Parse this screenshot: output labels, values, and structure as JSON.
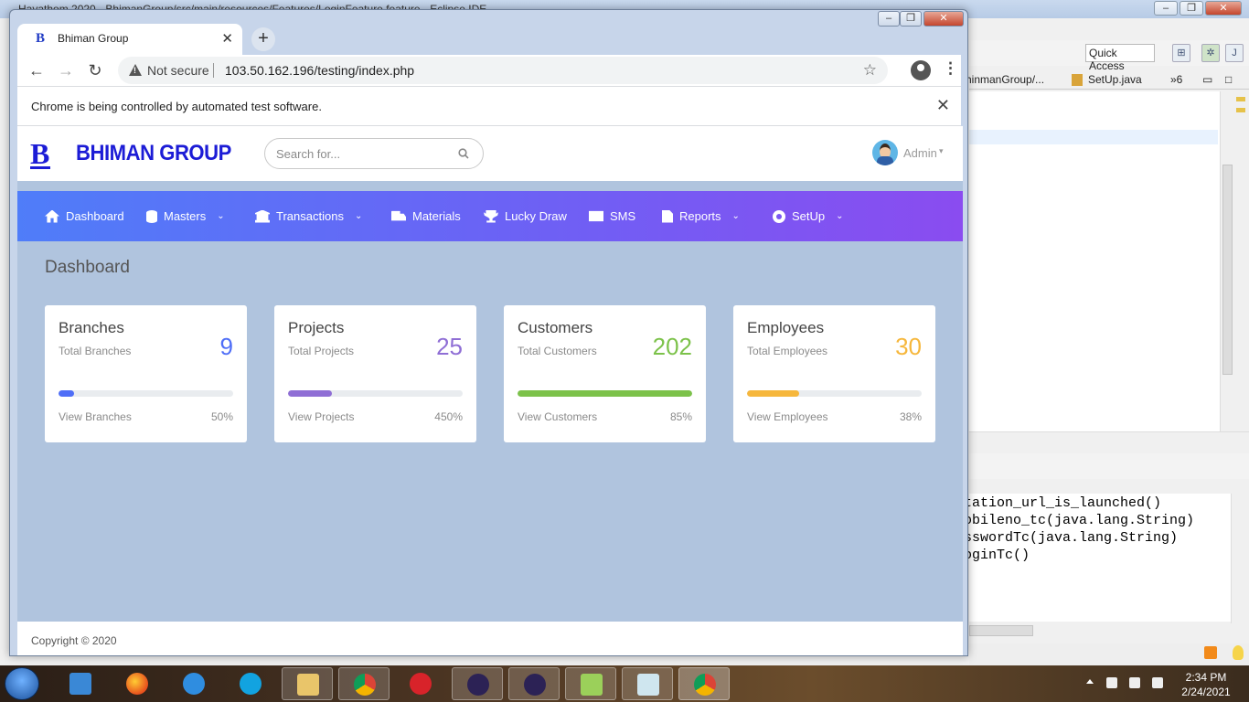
{
  "eclipse": {
    "title": "Hayathom 2020 - BhimanGroup/src/main/resources/Features/LoginFeature.feature - Eclipse IDE",
    "quick_access": "Quick Access",
    "tabs": [
      "hinmanGroup/...",
      "SetUp.java",
      "»6"
    ],
    "console_lines": [
      "tation_url_is_launched()",
      "obileno_tc(java.lang.String)",
      "sswordTc(java.lang.String)",
      "oginTc()"
    ]
  },
  "browser": {
    "tab_title": "Bhiman Group",
    "tab_favicon": "B",
    "not_secure": "Not secure",
    "url": "103.50.162.196/testing/index.php",
    "infobar_message": "Chrome is being controlled by automated test software."
  },
  "site": {
    "logo_letter": "B",
    "logo_text": "BHIMAN GROUP",
    "search_placeholder": "Search for...",
    "user_name": "Admin",
    "nav": [
      {
        "label": "Dashboard",
        "icon": "home-icon",
        "has_caret": false
      },
      {
        "label": "Masters",
        "icon": "database-icon",
        "has_caret": true
      },
      {
        "label": "Transactions",
        "icon": "bank-icon",
        "has_caret": true
      },
      {
        "label": "Materials",
        "icon": "truck-icon",
        "has_caret": false
      },
      {
        "label": "Lucky Draw",
        "icon": "trophy-icon",
        "has_caret": false
      },
      {
        "label": "SMS",
        "icon": "envelope-icon",
        "has_caret": false
      },
      {
        "label": "Reports",
        "icon": "file-icon",
        "has_caret": true
      },
      {
        "label": "SetUp",
        "icon": "gear-icon",
        "has_caret": true
      }
    ],
    "page_title": "Dashboard",
    "cards": [
      {
        "title": "Branches",
        "subtitle": "Total Branches",
        "value": "9",
        "link": "View Branches",
        "percent": "50%",
        "progress": 0.09,
        "color": "#4f6ef7"
      },
      {
        "title": "Projects",
        "subtitle": "Total Projects",
        "value": "25",
        "link": "View Projects",
        "percent": "450%",
        "progress": 0.25,
        "color": "#8f6ed5"
      },
      {
        "title": "Customers",
        "subtitle": "Total Customers",
        "value": "202",
        "link": "View Customers",
        "percent": "85%",
        "progress": 1.0,
        "color": "#7cc24a"
      },
      {
        "title": "Employees",
        "subtitle": "Total Employees",
        "value": "30",
        "link": "View Employees",
        "percent": "38%",
        "progress": 0.3,
        "color": "#f6b73c"
      }
    ],
    "footer": "Copyright © 2020"
  },
  "taskbar": {
    "time": "2:34 PM",
    "date": "2/24/2021"
  }
}
